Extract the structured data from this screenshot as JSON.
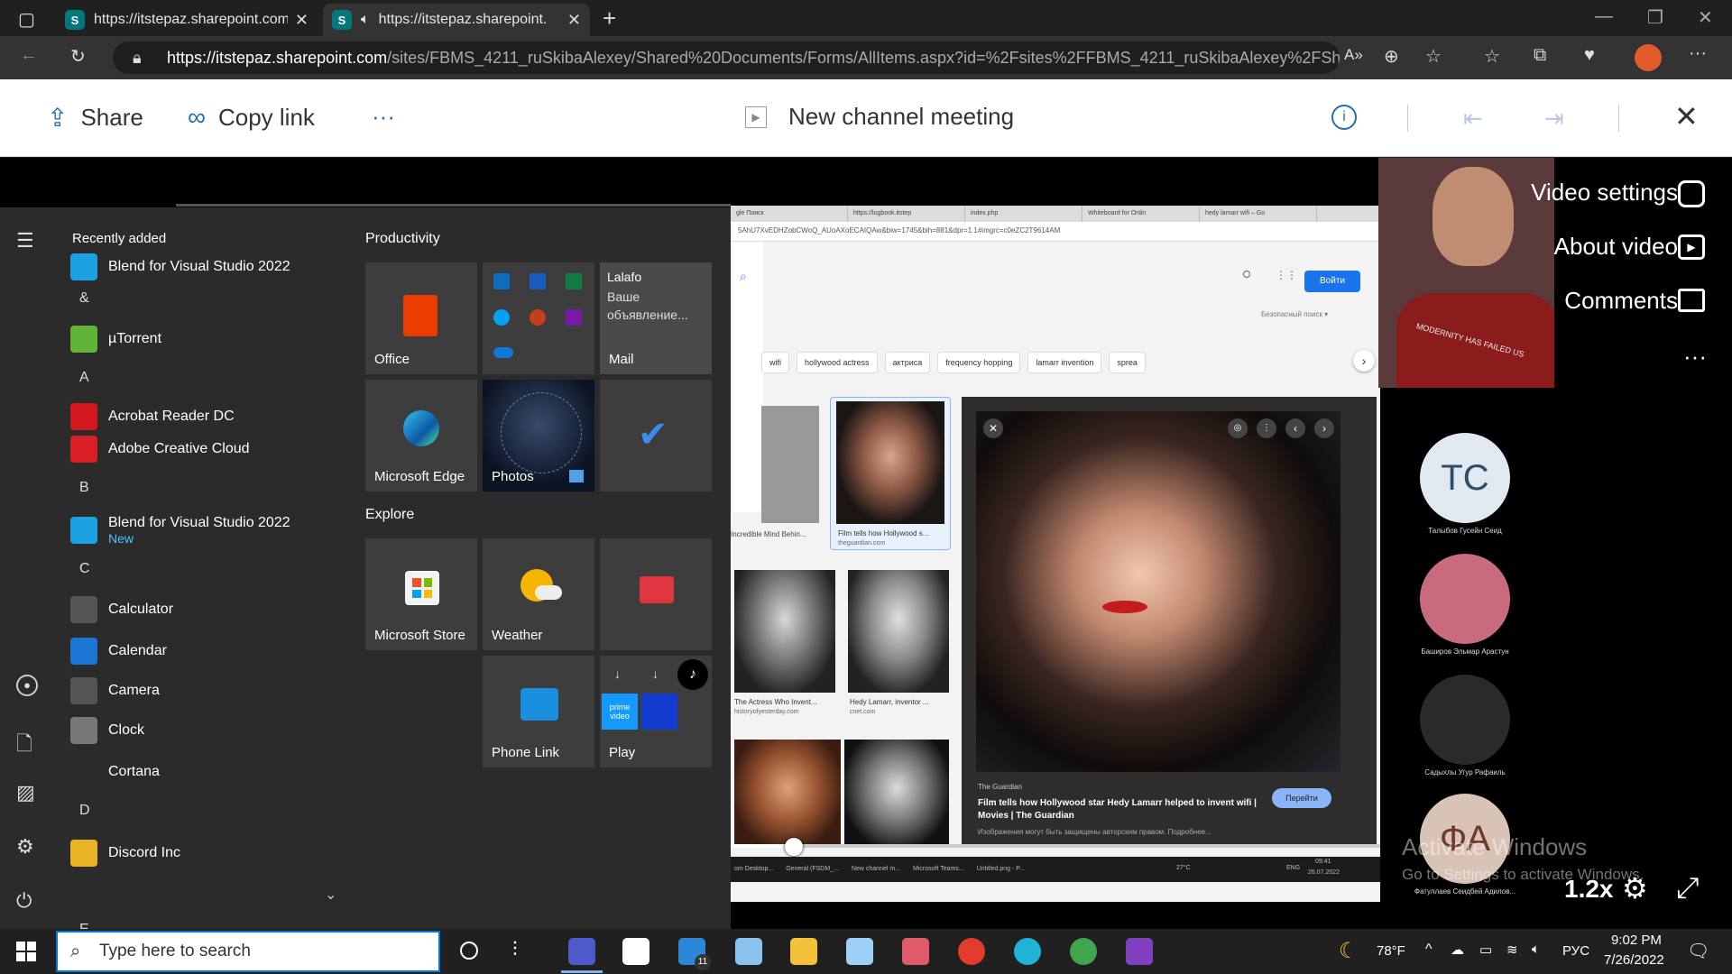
{
  "browser": {
    "tabs": [
      {
        "label": "https://itstepaz.sharepoint.com/:",
        "active": false
      },
      {
        "label": "https://itstepaz.sharepoint.c",
        "active": true
      }
    ],
    "url_host": "https://itstepaz.sharepoint.com",
    "url_path": "/sites/FBMS_4211_ruSkibaAlexey/Shared%20Documents/Forms/AllItems.aspx?id=%2Fsites%2FFBMS_4211_ruSkibaAlexey%2FShared%..."
  },
  "viewer": {
    "share_label": "Share",
    "copy_link_label": "Copy link",
    "more_label": "···",
    "title": "New channel meeting"
  },
  "start_menu": {
    "recently_added_label": "Recently added",
    "apps": [
      {
        "label": "Blend for Visual Studio 2022",
        "icon": "blend-icon",
        "color": "#1ba1e2"
      },
      {
        "letter": "&"
      },
      {
        "label": "µTorrent",
        "icon": "utorrent-icon",
        "color": "#5fb336"
      },
      {
        "letter": "A"
      },
      {
        "label": "Acrobat Reader DC",
        "icon": "acrobat-icon",
        "color": "#d4171c"
      },
      {
        "label": "Adobe Creative Cloud",
        "icon": "creative-cloud-icon",
        "color": "#da1f26"
      },
      {
        "letter": "B"
      },
      {
        "label": "Blend for Visual Studio 2022",
        "sub": "New",
        "icon": "blend-icon",
        "color": "#1ba1e2"
      },
      {
        "letter": "C"
      },
      {
        "label": "Calculator",
        "icon": "calculator-icon",
        "color": "#555"
      },
      {
        "label": "Calendar",
        "icon": "calendar-icon",
        "color": "#1976d2"
      },
      {
        "label": "Camera",
        "icon": "camera-icon",
        "color": "#555"
      },
      {
        "label": "Clock",
        "icon": "clock-icon",
        "color": "#777"
      },
      {
        "label": "Cortana",
        "icon": "cortana-icon",
        "color": "#2b2b2b"
      },
      {
        "letter": "D"
      },
      {
        "label": "Discord Inc",
        "icon": "folder-icon",
        "color": "#e8b425"
      }
    ],
    "productivity_label": "Productivity",
    "explore_label": "Explore",
    "tiles": {
      "office": "Office",
      "mail_sender": "Lalafo",
      "mail_preview": "Ваше объявление...",
      "mail": "Mail",
      "edge": "Microsoft Edge",
      "photos": "Photos",
      "store": "Microsoft Store",
      "weather": "Weather",
      "phone_link": "Phone Link",
      "play": "Play"
    }
  },
  "embedded": {
    "tabs": [
      "gle Поиск",
      "https://logbook.itstep",
      "index.php",
      "Whiteboard for Onlin",
      "hedy lamarr wifi – Go"
    ],
    "url": "5AhU7XvEDHZobCWoQ_AUoAXoECAIQAw&biw=1745&bih=881&dpr=1.1#imgrc=c0eZC2T9614AM",
    "signin": "Войти",
    "safesearch": "Безопасный поиск ▾",
    "chips": [
      "wifi",
      "hollywood actress",
      "актриса",
      "frequency hopping",
      "lamarr invention",
      "sprea"
    ],
    "results": [
      {
        "caption": "Incredible Mind Behin..."
      },
      {
        "caption": "Film tells how Hollywood s...",
        "source": "theguardian.com"
      },
      {
        "caption": "The Actress Who Invent...",
        "source": "historyofyesterday.com"
      },
      {
        "caption": "Hedy Lamarr, inventor ...",
        "source": "cnet.com"
      }
    ],
    "preview_source": "The Guardian",
    "preview_title": "Film tells how Hollywood star Hedy Lamarr helped to invent wifi | Movies | The Guardian",
    "preview_button": "Перейти",
    "preview_note": "Изображения могут быть защищены авторским правом. Подробнее...",
    "taskbar_items": [
      "om Desktop...",
      "General (FSDM_...",
      "New channel m...",
      "Microsoft Teams...",
      "Untitled.png - P..."
    ],
    "taskbar_temp": "27°C",
    "taskbar_lang": "ENG",
    "taskbar_time": "09:41",
    "taskbar_date": "26.07.2022"
  },
  "side": {
    "video_settings": "Video settings",
    "about_video": "About video",
    "comments": "Comments",
    "more": "···",
    "camera_shirt_text": "MODERNITY HAS FAILED US",
    "participants": [
      {
        "initials": "TC",
        "name": "Талыбов Гусейн Сеид",
        "color": "#dfe9ef",
        "text_color": "#2d4d6a"
      },
      {
        "initials": "",
        "name": "Баширов Эльмар Арастун",
        "color": "#c96b7d"
      },
      {
        "initials": "",
        "name": "Садыхлы Угур Рафаиль",
        "color": "#2a2a2a"
      },
      {
        "initials": "ФА",
        "name": "Фатуллаев Сеидбей Адилов...",
        "color": "#d9c3b7",
        "text_color": "#6e3a2b"
      }
    ],
    "activate_title": "Activate Windows",
    "activate_sub": "Go to Settings to activate Windows.",
    "speed": "1.2x"
  },
  "taskbar": {
    "search_placeholder": "Type here to search",
    "mail_badge": "11",
    "temp": "78°F",
    "lang": "РУС",
    "time": "9:02 PM",
    "date": "7/26/2022"
  }
}
